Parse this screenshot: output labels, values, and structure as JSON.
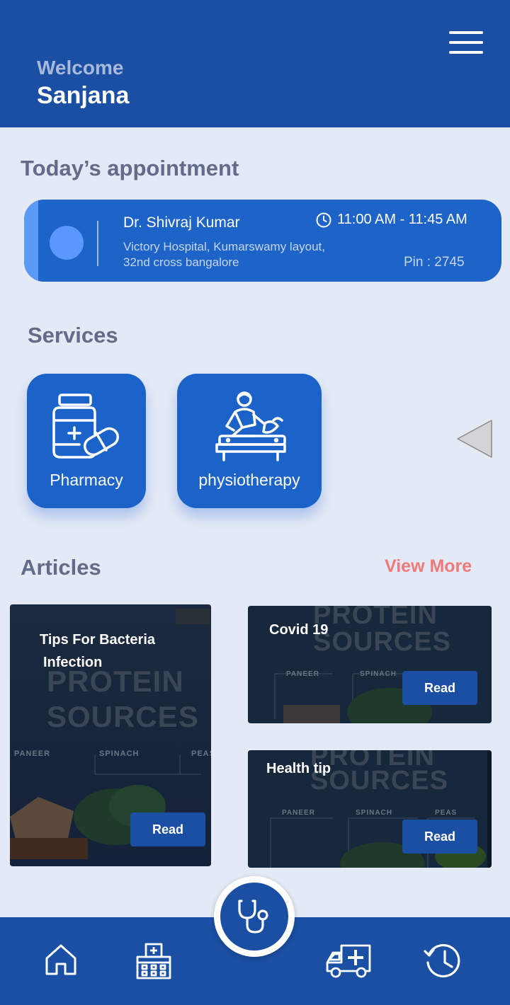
{
  "header": {
    "welcome": "Welcome",
    "username": "Sanjana"
  },
  "appointment": {
    "section_title": "Today’s appointment",
    "doctor": "Dr. Shivraj Kumar",
    "address_line1": "Victory Hospital, Kumarswamy layout,",
    "address_line2": "32nd cross bangalore",
    "time": "11:00 AM - 11:45 AM",
    "pin": "Pin : 2745"
  },
  "services": {
    "section_title": "Services",
    "items": [
      {
        "label": "Pharmacy",
        "icon": "medicine-bottle-icon"
      },
      {
        "label": "physiotherapy",
        "icon": "physiotherapy-icon"
      }
    ]
  },
  "articles": {
    "section_title": "Articles",
    "view_more": "View More",
    "items": [
      {
        "title_line1": "Tips For Bacteria",
        "title_line2": "Infection",
        "read": "Read"
      },
      {
        "title": "Covid 19",
        "read": "Read"
      },
      {
        "title": "Health tip",
        "read": "Read"
      }
    ],
    "image_text": {
      "big1": "PROTEIN",
      "big2": "SOURCES",
      "paneer": "PANEER",
      "spinach": "SPINACH",
      "peas": "PEAS"
    }
  },
  "colors": {
    "brand": "#1a4fa3",
    "card": "#1c63c9",
    "accent": "#f07a7a",
    "background": "#e4eaf5"
  },
  "bottom_nav": [
    "home-icon",
    "hospital-icon",
    "stethoscope-icon",
    "ambulance-icon",
    "history-icon"
  ]
}
